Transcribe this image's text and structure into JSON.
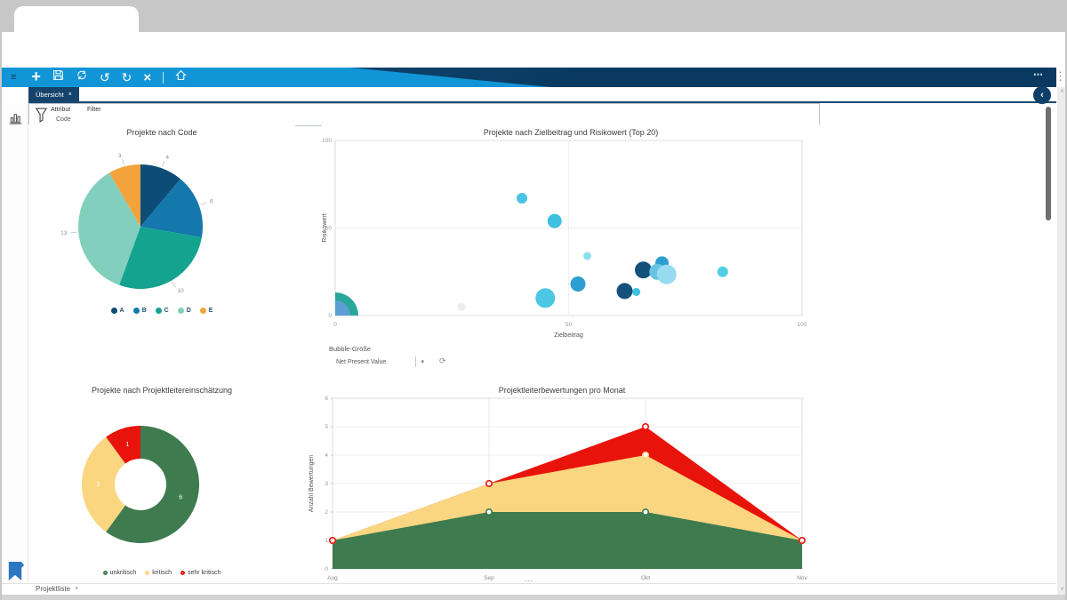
{
  "icons": {
    "back": "←",
    "forward": "→",
    "reload": "↻",
    "menu": "≡",
    "plus": "+",
    "undo": "↺",
    "redo": "↻",
    "close": "×",
    "sync": "⟳",
    "star": "★",
    "dots_vertical": "⋮",
    "overflow": "⋯",
    "caret": "▾",
    "refresh": "⟳",
    "collapse": "‹",
    "splitter": "⋯",
    "scroll_up": "˄",
    "scroll_down": "˅",
    "tab_close": "×"
  },
  "tabs": {
    "top_tab": "Übersicht",
    "bottom_tab": "Projektliste"
  },
  "filter_bar": {
    "attribut_label": "Attribut",
    "attribut_value": "Code",
    "filter_label": "Filter"
  },
  "bubble_size": {
    "label": "Bubble-Größe",
    "value": "Net Present Value"
  },
  "colors": {
    "toolbar_blue": "#1295d6",
    "toolbar_navy": "#0a3a61",
    "tab_navy": "#15436b"
  },
  "chart_data": [
    {
      "type": "pie",
      "title": "Projekte nach Code",
      "categories": [
        "A",
        "B",
        "C",
        "D",
        "E"
      ],
      "values": [
        4,
        6,
        10,
        13,
        3
      ],
      "colors": [
        "#0e4c78",
        "#1478ad",
        "#14a38f",
        "#82cfbd",
        "#f2a33c"
      ],
      "legend_position": "bottom"
    },
    {
      "type": "scatter",
      "title": "Projekte nach Zielbeitrag und Risikowert (Top 20)",
      "xlabel": "Zielbeitrag",
      "ylabel": "Risikowert",
      "xlim": [
        0,
        100
      ],
      "ylim": [
        0,
        100
      ],
      "xticks": [
        0,
        50,
        100
      ],
      "yticks": [
        0,
        50,
        100
      ],
      "points": [
        {
          "x": 0,
          "y": 0,
          "r": 26,
          "color": "#2aa79b"
        },
        {
          "x": 0,
          "y": 0,
          "r": 17,
          "color": "#5b9fd3"
        },
        {
          "x": 27,
          "y": 5,
          "r": 4.5,
          "color": "#ebebeb"
        },
        {
          "x": 40,
          "y": 67,
          "r": 6,
          "color": "#4ac3e2"
        },
        {
          "x": 47,
          "y": 54,
          "r": 8,
          "color": "#3fc0e0"
        },
        {
          "x": 54,
          "y": 34,
          "r": 4.5,
          "color": "#90dcee"
        },
        {
          "x": 45,
          "y": 10,
          "r": 11,
          "color": "#4cc8e2"
        },
        {
          "x": 52,
          "y": 18,
          "r": 8.5,
          "color": "#2c9ed2"
        },
        {
          "x": 70,
          "y": 30,
          "r": 7.5,
          "color": "#2c9ed2"
        },
        {
          "x": 66,
          "y": 26,
          "r": 9.5,
          "color": "#14517a"
        },
        {
          "x": 69,
          "y": 25,
          "r": 9,
          "color": "#68c2e6"
        },
        {
          "x": 71,
          "y": 23.5,
          "r": 11,
          "color": "#97dbf0"
        },
        {
          "x": 62,
          "y": 14,
          "r": 9,
          "color": "#14517a"
        },
        {
          "x": 64.5,
          "y": 13.5,
          "r": 4.5,
          "color": "#3fc0e0"
        },
        {
          "x": 83,
          "y": 25,
          "r": 6,
          "color": "#52cfe2"
        }
      ]
    },
    {
      "type": "donut",
      "title": "Projekte nach Projektleitereinschätzung",
      "categories": [
        "unkritisch",
        "kritisch",
        "sehr kritisch"
      ],
      "values": [
        6,
        3,
        1
      ],
      "colors": [
        "#3e7b4f",
        "#fad681",
        "#e8140c"
      ],
      "legend_position": "bottom"
    },
    {
      "type": "area",
      "title": "Projektleiterbewertungen pro Monat",
      "ylabel": "Anzahl Bewertungen",
      "categories": [
        "Aug",
        "Sep",
        "Okt",
        "Nov"
      ],
      "ylim": [
        0,
        6
      ],
      "yticks": [
        0,
        1,
        2,
        3,
        4,
        5,
        6
      ],
      "series": [
        {
          "name": "sehr kritisch",
          "values": [
            1,
            3,
            5,
            1
          ],
          "color": "#e8140c"
        },
        {
          "name": "kritisch",
          "values": [
            1,
            3,
            4,
            1
          ],
          "color": "#fad681"
        },
        {
          "name": "unkritisch",
          "values": [
            1,
            2,
            2,
            1
          ],
          "color": "#3e7b4f"
        }
      ]
    }
  ]
}
